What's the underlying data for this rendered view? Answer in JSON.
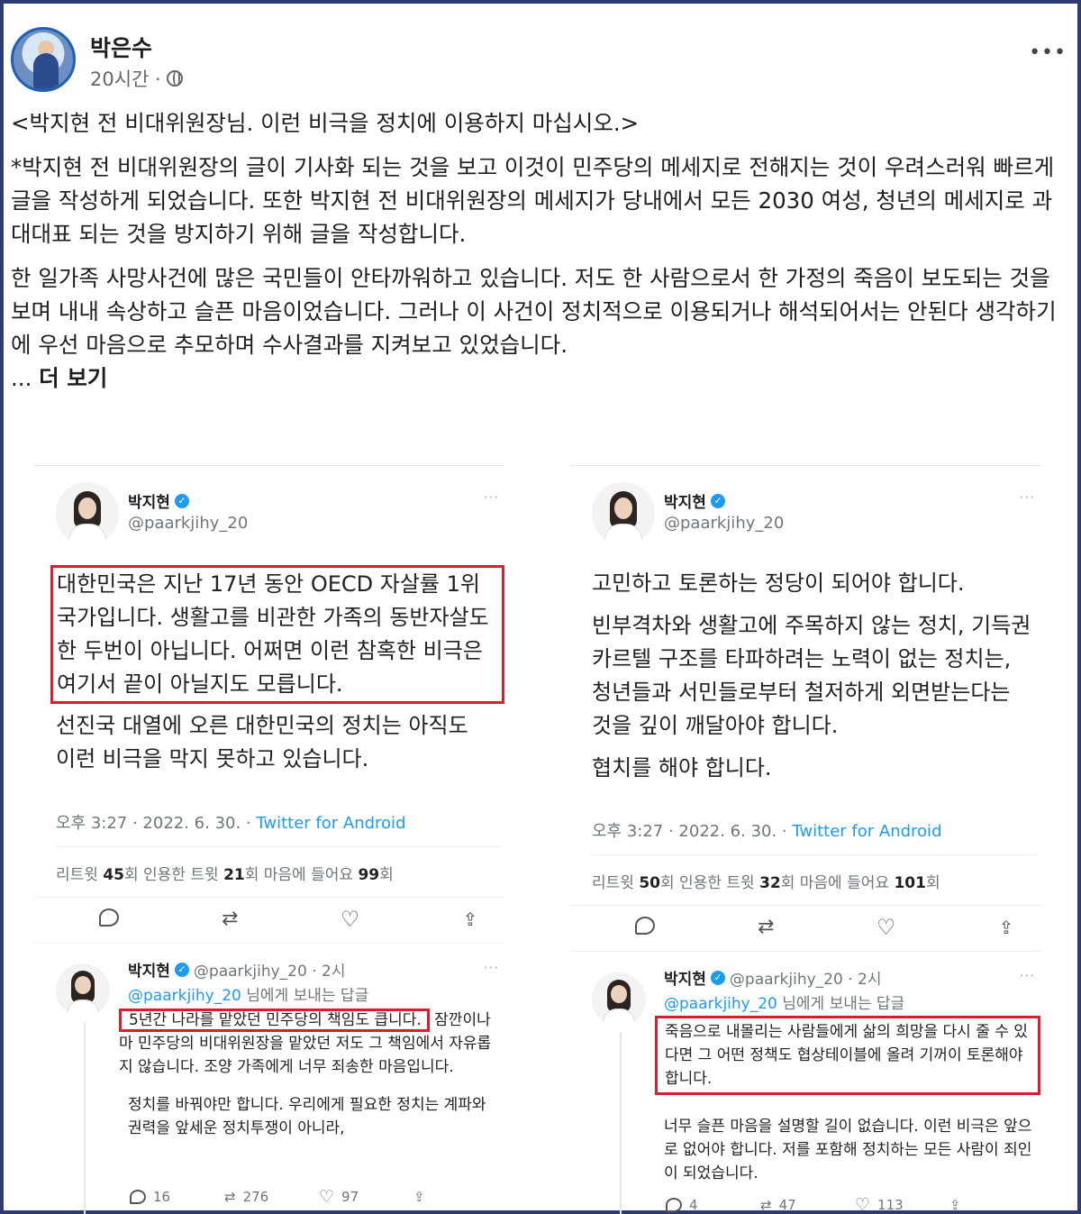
{
  "post": {
    "author": "박은수",
    "time": "20시간 ·",
    "more": "•••",
    "title": "<박지현 전 비대위원장님. 이런 비극을 정치에 이용하지 마십시오.>",
    "paragraph1": "*박지현 전 비대위원장의 글이 기사화 되는 것을 보고 이것이 민주당의 메세지로 전해지는 것이 우려스러워 빠르게 글을 작성하게 되었습니다. 또한 박지현 전 비대위원장의 메세지가 당내에서 모든 2030 여성, 청년의 메세지로 과대대표 되는 것을 방지하기 위해 글을 작성합니다.",
    "paragraph2": "한 일가족 사망사건에 많은 국민들이 안타까워하고 있습니다. 저도 한 사람으로서 한 가정의 죽음이 보도되는 것을 보며 내내 속상하고 슬픈 마음이었습니다. 그러나 이 사건이 정치적으로 이용되거나 해석되어서는 안된다 생각하기에 우선 마음으로 추모하며 수사결과를 지켜보고 있었습니다.",
    "ellipsis": "... ",
    "see_more": "더 보기"
  },
  "tweets": [
    {
      "name": "박지현",
      "handle": "@paarkjihy_20",
      "dots": "···",
      "boxed": "대한민국은 지난 17년 동안 OECD 자살률 1위 국가입니다. 생활고를 비관한 가족의 동반자살도 한 두번이 아닙니다. 어쩌면 이런 참혹한 비극은 여기서 끝이 아닐지도 모릅니다.",
      "body": "선진국 대열에 오른 대한민국의 정치는 아직도 이런 비극을 막지 못하고 있습니다.",
      "time": "오후 3:27 · 2022. 6. 30. · ",
      "source": "Twitter for Android",
      "stats": {
        "rt_label": "리트윗 ",
        "rt": "45",
        "rt_unit": "회",
        "quote_label": "  인용한 트윗 ",
        "quote": "21",
        "quote_unit": "회",
        "like_label": "  마음에 들어요 ",
        "like": "99",
        "like_unit": "회"
      },
      "reply": {
        "name": "박지현",
        "handle": "@paarkjihy_20 · 2시",
        "to_link": "@paarkjihy_20",
        "to_text": " 님에게 보내는 답글",
        "boxed": "5년간 나라를 맡았던 민주당의 책임도 큽니다.",
        "body1": " 잠깐이나마 민주당의 비대위원장을 맡았던 저도 그 책임에서 자유롭지 않습니다. 조양 가족에게 너무 죄송한 마음입니다.",
        "body2": "정치를 바꿔야만 합니다. 우리에게 필요한 정치는 계파와 권력을 앞세운 정치투쟁이 아니라,",
        "replies": "16",
        "retweets": "276",
        "likes": "97"
      }
    },
    {
      "name": "박지현",
      "handle": "@paarkjihy_20",
      "dots": "···",
      "p1": "고민하고 토론하는 정당이 되어야 합니다.",
      "p2": "빈부격차와 생활고에 주목하지 않는 정치, 기득권 카르텔 구조를 타파하려는 노력이 없는 정치는, 청년들과 서민들로부터 철저하게 외면받는다는 것을 깊이 깨달아야 합니다.",
      "p3": "협치를 해야 합니다.",
      "time": "오후 3:27 · 2022. 6. 30. · ",
      "source": "Twitter for Android",
      "stats": {
        "rt_label": "리트윗 ",
        "rt": "50",
        "rt_unit": "회",
        "quote_label": "  인용한 트윗 ",
        "quote": "32",
        "quote_unit": "회",
        "like_label": "  마음에 들어요 ",
        "like": "101",
        "like_unit": "회"
      },
      "reply": {
        "name": "박지현",
        "handle": "@paarkjihy_20 · 2시",
        "to_link": "@paarkjihy_20",
        "to_text": " 님에게 보내는 답글",
        "boxed": "죽음으로 내몰리는 사람들에게 삶의 희망을 다시 줄 수 있다면 그 어떤 정책도 협상테이블에 올려 기꺼이 토론해야 합니다.",
        "body2": "너무 슬픈 마음을 설명할 길이 없습니다. 이런 비극은 앞으로 없어야 합니다. 저를 포함해 정치하는 모든 사람이 죄인이 되었습니다.",
        "replies": "4",
        "retweets": "47",
        "likes": "113"
      }
    }
  ],
  "icons": {
    "retweet": "⇄",
    "like": "♡",
    "share": "⇪"
  }
}
